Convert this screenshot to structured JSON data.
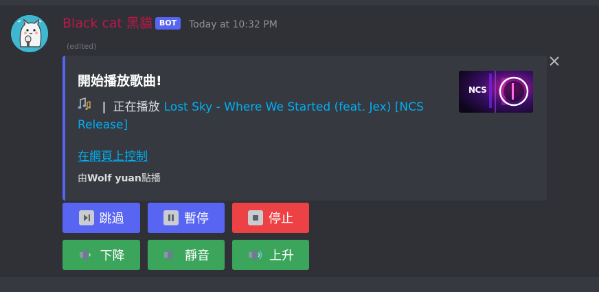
{
  "message": {
    "username": "Black cat 黑貓",
    "badge": "BOT",
    "timestamp": "Today at 10:32 PM",
    "edited": "(edited)"
  },
  "embed": {
    "title": "開始播放歌曲!",
    "separator": "|",
    "now_playing_label": "正在播放",
    "song_title": "Lost Sky - Where We Started (feat. Jex) [NCS Release]",
    "control_link": "在網頁上控制",
    "requester_prefix": "由",
    "requester_name": "Wolf yuan",
    "requester_suffix": "點播",
    "thumbnail_logo": "NCS",
    "accent_color": "#5865f2"
  },
  "buttons": {
    "row1": [
      {
        "label": "跳過",
        "icon": "skip-icon",
        "color": "#5865f2"
      },
      {
        "label": "暫停",
        "icon": "pause-icon",
        "color": "#5865f2"
      },
      {
        "label": "停止",
        "icon": "stop-icon",
        "color": "#ed4245"
      }
    ],
    "row2": [
      {
        "label": "下降",
        "icon": "volume-down-icon",
        "color": "#3ba55c"
      },
      {
        "label": "靜音",
        "icon": "volume-mute-icon",
        "color": "#3ba55c"
      },
      {
        "label": "上升",
        "icon": "volume-up-icon",
        "color": "#3ba55c"
      }
    ]
  }
}
